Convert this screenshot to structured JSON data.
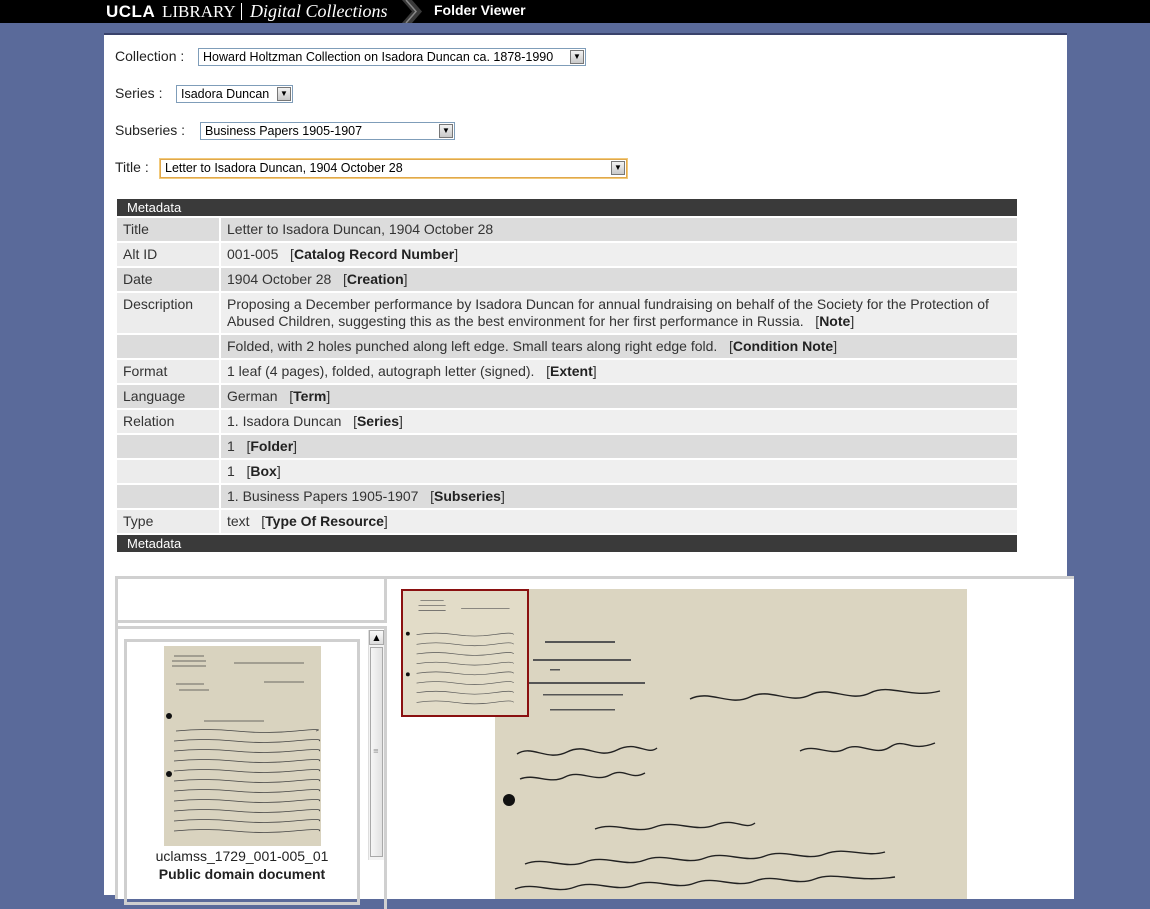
{
  "header": {
    "brand_ucla": "UCLA",
    "brand_library": "LIBRARY",
    "brand_collection": "Digital Collections",
    "breadcrumb": "Folder Viewer"
  },
  "filters": {
    "collection": {
      "label": "Collection :",
      "value": "Howard Holtzman Collection on Isadora Duncan ca. 1878-1990"
    },
    "series": {
      "label": "Series :",
      "value": "Isadora Duncan"
    },
    "subseries": {
      "label": "Subseries :",
      "value": "Business Papers 1905-1907"
    },
    "title": {
      "label": "Title :",
      "value": "Letter to Isadora Duncan, 1904 October 28"
    }
  },
  "metadata": {
    "header": "Metadata",
    "footer": "Metadata",
    "rows": [
      {
        "key": "Title",
        "value": "Letter to Isadora Duncan, 1904 October 28",
        "qual": ""
      },
      {
        "key": "Alt ID",
        "value": "001-005",
        "qual": "Catalog Record Number"
      },
      {
        "key": "Date",
        "value": "1904 October 28",
        "qual": "Creation"
      },
      {
        "key": "Description",
        "value": "Proposing a December performance by Isadora Duncan for annual fundraising on behalf of the Society for the Protection of Abused Children, suggesting this as the best environment for her first performance in Russia.",
        "qual": "Note"
      },
      {
        "key": "",
        "value": "Folded, with 2 holes punched along left edge. Small tears along right edge fold.",
        "qual": "Condition Note"
      },
      {
        "key": "Format",
        "value": "1 leaf (4 pages), folded, autograph letter (signed).",
        "qual": "Extent"
      },
      {
        "key": "Language",
        "value": "German",
        "qual": "Term"
      },
      {
        "key": "Relation",
        "value": "1. Isadora Duncan",
        "qual": "Series"
      },
      {
        "key": "",
        "value": "1",
        "qual": "Folder"
      },
      {
        "key": "",
        "value": "1",
        "qual": "Box"
      },
      {
        "key": "",
        "value": "1. Business Papers 1905-1907",
        "qual": "Subseries"
      },
      {
        "key": "Type",
        "value": "text",
        "qual": "Type Of Resource"
      }
    ]
  },
  "viewer": {
    "thumbnail_caption": "uclamss_1729_001-005_01",
    "thumbnail_rights": "Public domain document"
  }
}
